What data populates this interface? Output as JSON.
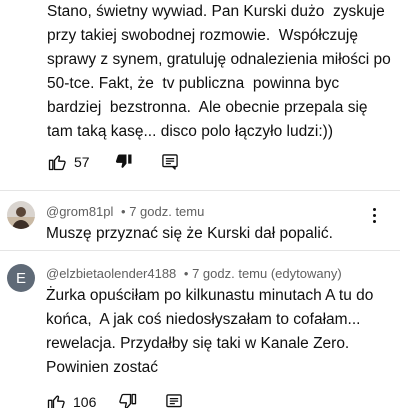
{
  "comment_top": {
    "text": "Stano, świetny wywiad. Pan Kurski dużo  zyskuje przy takiej swobodnej rozmowie.  Współczuję sprawy z synem, gratuluję odnalezienia miłości po 50-tce. Fakt, że  tv publiczna  powinna byc bardziej  bezstronna.  Ale obecnie przepala się tam taką kasę... disco polo łączyło ludzi:))",
    "likes": "57"
  },
  "comment_grom": {
    "author": "@grom81pl",
    "time": "• 7 godz. temu",
    "text": "Muszę przyznać się że Kurski dał popalić."
  },
  "comment_elzbieta": {
    "avatar_letter": "E",
    "author": "@elzbietaolender4188",
    "time": "• 7 godz. temu (edytowany)",
    "text": "Żurka opuściłam po kilkunastu minutach A tu do końca,  A jak coś niedosłyszałam to cofałam... rewelacja. Przydałby się taki w Kanale Zero. Powinien zostać",
    "likes": "106"
  },
  "icons": {
    "like": "thumb-up-icon",
    "dislike": "thumb-down-icon",
    "reply": "comment-icon",
    "more": "more-vert-icon"
  }
}
